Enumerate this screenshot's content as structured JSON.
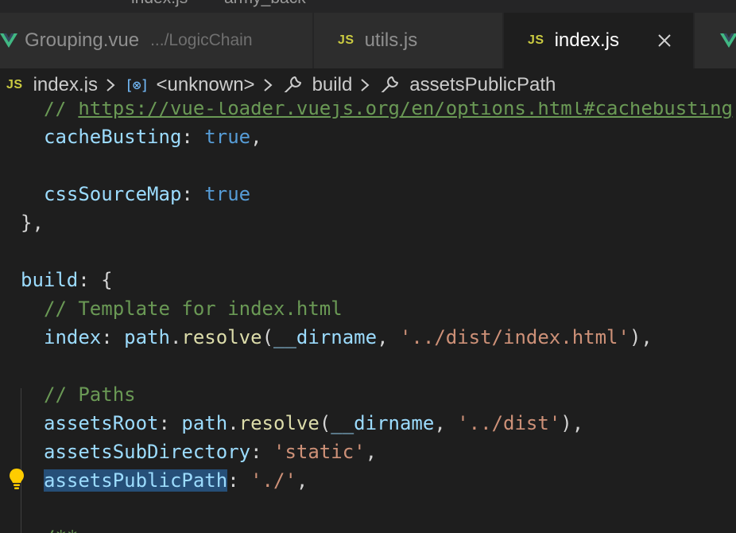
{
  "colors": {
    "editor_bg": "#1e1e1e",
    "tab_inactive_bg": "#2d2d2d",
    "js_icon": "#cbcb41",
    "vue_icon": "#41b883",
    "comment": "#6a9955",
    "property": "#9cdcfe",
    "keyword": "#569cd6",
    "string": "#ce9178",
    "function": "#dcdcaa",
    "selection": "#264f78",
    "lightbulb": "#ffcc00"
  },
  "top_strip": {
    "text_a": "index.js",
    "text_b": "army_back"
  },
  "tabs": [
    {
      "icon": "vue-icon",
      "label": "Grouping.vue",
      "description": ".../LogicChain",
      "active": false
    },
    {
      "icon": "js-icon",
      "icon_text": "JS",
      "label": "utils.js",
      "active": false
    },
    {
      "icon": "js-icon",
      "icon_text": "JS",
      "label": "index.js",
      "active": true
    }
  ],
  "breadcrumb": {
    "file_icon_text": "JS",
    "file": "index.js",
    "symbol_icon_text": "[⊗]",
    "symbol": "<unknown>",
    "build": "build",
    "leaf": "assetsPublicPath"
  },
  "code": {
    "l0_comment": "// ",
    "l0_link": "https://vue-loader.vuejs.org/en/options.html#cachebusting",
    "l1_prop": "cacheBusting",
    "l1_colon": ": ",
    "l1_value": "true",
    "l1_comma": ",",
    "l3_prop": "cssSourceMap",
    "l3_colon": ": ",
    "l3_value": "true",
    "l4_close": "},",
    "l6_prop": "build",
    "l6_rest": ": {",
    "l7_comment": "// Template for index.html",
    "l8_prop": "index",
    "l8_colon": ": ",
    "l8_obj": "path",
    "l8_dot": ".",
    "l8_fn": "resolve",
    "l8_open": "(",
    "l8_arg": "__dirname",
    "l8_sep": ", ",
    "l8_str": "'../dist/index.html'",
    "l8_close": "),",
    "l10_comment": "// Paths",
    "l11_prop": "assetsRoot",
    "l11_colon": ": ",
    "l11_obj": "path",
    "l11_dot": ".",
    "l11_fn": "resolve",
    "l11_open": "(",
    "l11_arg": "__dirname",
    "l11_sep": ", ",
    "l11_str": "'../dist'",
    "l11_close": "),",
    "l12_prop": "assetsSubDirectory",
    "l12_colon": ": ",
    "l12_str": "'static'",
    "l12_comma": ",",
    "l13_prop": "assetsPublicPath",
    "l13_colon": ": ",
    "l13_str": "'./'",
    "l13_comma": ",",
    "l15_comment": "/**"
  }
}
